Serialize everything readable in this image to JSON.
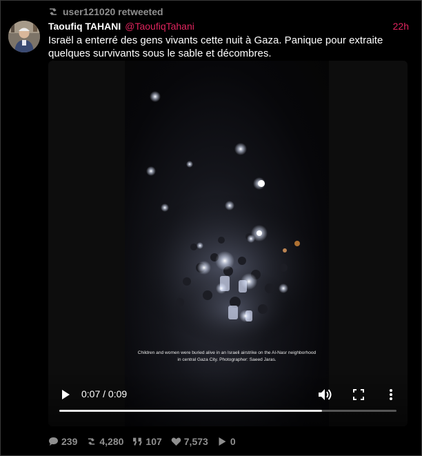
{
  "retweet": {
    "label": "user121020 retweeted"
  },
  "author": {
    "name": "Taoufiq TAHANI",
    "handle": "@TaoufiqTahani",
    "time": "22h"
  },
  "tweet": {
    "text": "Israël a enterré des gens vivants cette nuit à Gaza. Panique pour extraite quelques survivants sous le sable et décombres."
  },
  "video": {
    "caption": "Children and women were buried alive in an Israeli airstrike on the Al-Nasr neighborhood in central Gaza City. Photographer: Saeed Jaras.",
    "time": "0:07 / 0:09",
    "progress": 0.78
  },
  "actions": {
    "replies": "239",
    "retweets": "4,280",
    "quotes": "107",
    "likes": "7,573",
    "views": "0"
  },
  "icons": {
    "retweet": "retweet-icon",
    "reply": "speech-bubble-icon",
    "quote": "quote-icon",
    "like": "heart-icon",
    "view": "play-icon",
    "play": "play-icon",
    "volume": "volume-icon",
    "fullscreen": "fullscreen-icon",
    "menu": "kebab-menu-icon"
  },
  "colors": {
    "accent": "#e0245e",
    "muted": "#8f8f8f",
    "background": "#000000"
  }
}
